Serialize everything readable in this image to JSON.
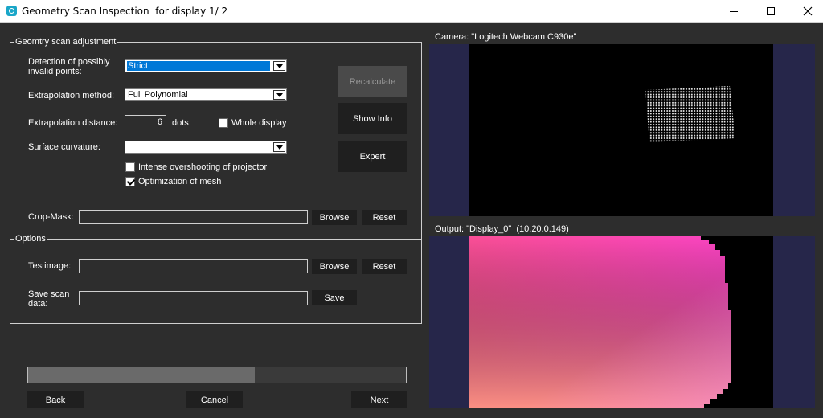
{
  "window": {
    "title": "Geometry Scan Inspection  for display 1/ 2",
    "controls": [
      "minimize",
      "maximize",
      "close"
    ]
  },
  "adjustment": {
    "legend": "Geomtry scan adjustment",
    "detection_label": "Detection of possibly\ninvalid points:",
    "detection_value": "Strict",
    "extrapolation_method_label": "Extrapolation method:",
    "extrapolation_method_value": "Full Polynomial",
    "extrapolation_distance_label": "Extrapolation distance:",
    "extrapolation_distance_value": "6",
    "extrapolation_distance_unit": "dots",
    "whole_display_label": "Whole display",
    "whole_display_checked": false,
    "surface_curvature_label": "Surface curvature:",
    "surface_curvature_value": "",
    "intense_overshooting_label": "Intense overshooting of projector",
    "intense_overshooting_checked": false,
    "optimization_label": "Optimization of mesh",
    "optimization_checked": true,
    "recalculate_label": "Recalculate",
    "show_info_label": "Show Info",
    "expert_label": "Expert",
    "crop_mask_label": "Crop-Mask:",
    "crop_mask_value": "",
    "browse_label": "Browse",
    "reset_label": "Reset"
  },
  "options": {
    "legend": "Options",
    "testimage_label": "Testimage:",
    "testimage_value": "",
    "browse_label": "Browse",
    "reset_label": "Reset",
    "save_scan_label": "Save scan\ndata:",
    "save_scan_value": "",
    "save_label": "Save"
  },
  "progress": {
    "value": 0.6
  },
  "nav": {
    "back_first": "B",
    "back_rest": "ack",
    "cancel_first": "C",
    "cancel_rest": "ancel",
    "next_first": "N",
    "next_rest": "ext"
  },
  "camera": {
    "title": "Camera: \"Logitech Webcam C930e\""
  },
  "output": {
    "title": "Output: \"Display_0\"  (10.20.0.149)"
  },
  "colors": {
    "background": "#2d2d2d",
    "accent": "#0078d7",
    "panel_border": "#26264a",
    "gradient_top_left": "#fb4f97",
    "gradient_top_right": "#fc44c4",
    "gradient_bottom_left": "#fd9c80",
    "gradient_bottom_right": "#f48ad8"
  }
}
